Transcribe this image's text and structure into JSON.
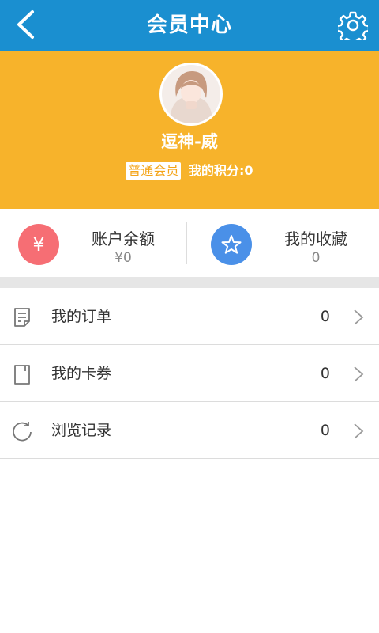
{
  "header": {
    "title": "会员中心",
    "back_icon": "chevron-left-icon",
    "settings_icon": "gear-icon"
  },
  "profile": {
    "username": "逗神-威",
    "member_level": "普通会员",
    "points_text": "我的积分:0",
    "background_color": "#f7b32b"
  },
  "quick": {
    "balance": {
      "label": "账户余额",
      "value": "¥0",
      "icon_text": "¥",
      "icon": "yen-icon",
      "color": "#f66e74"
    },
    "favorites": {
      "label": "我的收藏",
      "value": "0",
      "icon": "star-icon",
      "color": "#4a90e8"
    }
  },
  "menu": [
    {
      "label": "我的订单",
      "value": "0",
      "icon": "order-icon"
    },
    {
      "label": "我的卡券",
      "value": "0",
      "icon": "coupon-icon"
    },
    {
      "label": "浏览记录",
      "value": "0",
      "icon": "history-icon"
    }
  ]
}
